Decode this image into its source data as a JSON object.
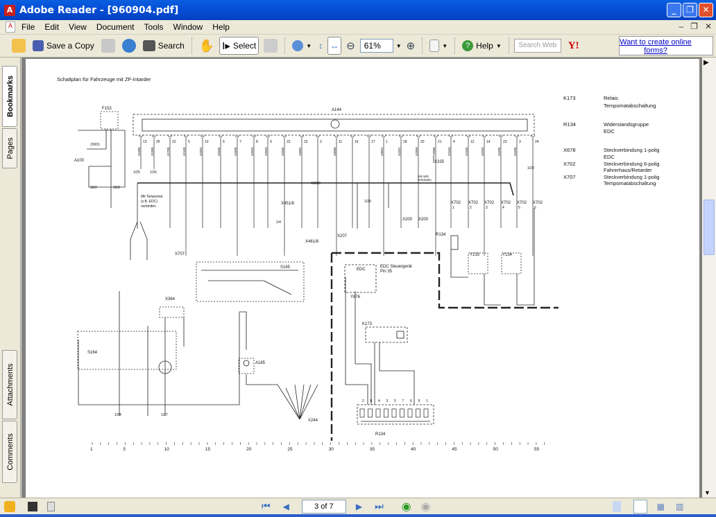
{
  "window": {
    "title": "Adobe Reader - [960904.pdf]",
    "controls": [
      "minimize",
      "restore",
      "close"
    ]
  },
  "menu": [
    "File",
    "Edit",
    "View",
    "Document",
    "Tools",
    "Window",
    "Help"
  ],
  "toolbar": {
    "save_copy": "Save a Copy",
    "search": "Search",
    "select": "Select",
    "zoom": "61%",
    "help": "Help",
    "search_web_placeholder": "Search Web",
    "ad_text": "Want to create online forms?"
  },
  "side_tabs": [
    "Bookmarks",
    "Pages",
    "Attachments",
    "Comments"
  ],
  "navigation": {
    "page_indicator": "3 of 7"
  },
  "document": {
    "title": "Schaltplan für Fahrzeuge mit ZF-Intarder",
    "legend": [
      {
        "code": "K173",
        "desc1": "Relais",
        "desc2": "Tempomatabschaltung"
      },
      {
        "code": "R134",
        "desc1": "Widerstandsgruppe",
        "desc2": "EDC"
      },
      {
        "code": "X678",
        "desc1": "Steckverbindung 1-polig",
        "desc2": "EDC"
      },
      {
        "code": "X702",
        "desc1": "Steckverbindung 6-polig",
        "desc2": "Fahrerhaus/Retarder"
      },
      {
        "code": "X707",
        "desc1": "Steckverbindung 1-polig",
        "desc2": "Tempomatabschaltung"
      }
    ],
    "labels": {
      "a144": "A144",
      "f153": "F153",
      "a100": "A100",
      "w15001": "15001",
      "w302": "30/2",
      "w30": "30/8",
      "w43005": "43005",
      "tempomat1": "Mit Tempomat",
      "tempomat2": "(z.B. EDC)",
      "tempomat3": "verbinden",
      "x451": "X451/8",
      "x461": "X461/8",
      "x707": "X707",
      "s165": "S165",
      "x364": "X364",
      "s164": "S164",
      "a185": "A185",
      "x244": "X244",
      "x335": "X335",
      "abs1": "Mit ABS",
      "abs2": "verbinden",
      "x200a": "X200",
      "x200b": "X200",
      "x207": "X207",
      "r134": "R134",
      "y133": "Y133",
      "y134": "Y134",
      "edc": "EDC",
      "edc_unit1": "EDC Steuergerät",
      "edc_unit2": "Pin 35",
      "y676": "Y676",
      "k173": "K173",
      "x702": "X702",
      "ref125": "1/25",
      "ref126": "1/26",
      "ref129": "1/29",
      "ref124": "1/24",
      "ref127": "1/27",
      "ref14": "1/4"
    },
    "pins": [
      "13",
      "26",
      "10",
      "5",
      "19",
      "6",
      "7",
      "8",
      "9",
      "22",
      "15",
      "2",
      "11",
      "16",
      "17",
      "1",
      "18",
      "20",
      "21",
      "4",
      "12",
      "14",
      "23",
      "3",
      "24"
    ],
    "wire_codes": [
      "31000",
      "31000",
      "42700",
      "43100",
      "42502",
      "42505",
      "42506",
      "42504",
      "42503",
      "42505",
      "15002",
      "",
      "43008",
      "",
      "",
      "43001",
      "42201",
      "43300",
      "72080",
      "43104",
      "43105",
      "43203",
      "43205",
      "43206",
      ""
    ],
    "x702_pins": [
      "1",
      "2",
      "3",
      "4",
      "5",
      "6"
    ],
    "r134_pins": [
      "2",
      "8",
      "4",
      "3",
      "5",
      "7",
      "6",
      "9",
      "1"
    ],
    "scale": [
      "1",
      "5",
      "10",
      "15",
      "20",
      "25",
      "30",
      "35",
      "40",
      "45",
      "50",
      "55"
    ]
  }
}
